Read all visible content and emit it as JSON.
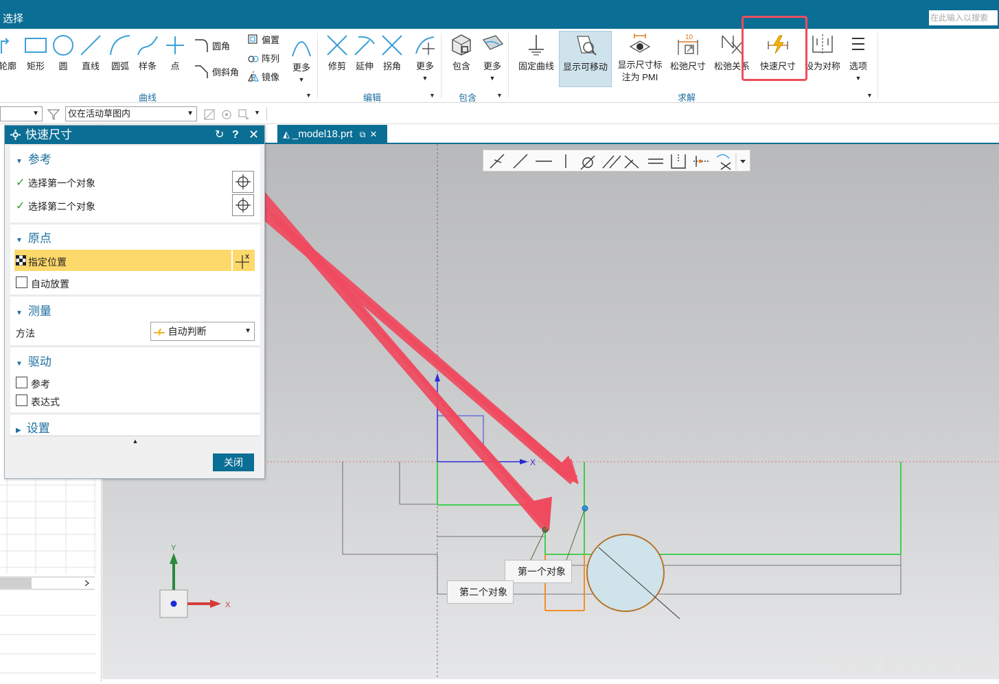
{
  "titlebar": {
    "menu": "选择",
    "search_placeholder": "在此输入以搜索"
  },
  "ribbon": {
    "curve": {
      "items": [
        "轮廓",
        "矩形",
        "圆",
        "直线",
        "圆弧",
        "样条",
        "点"
      ],
      "fillet": "圆角",
      "chamfer": "倒斜角",
      "offset": "偏置",
      "array": "阵列",
      "mirror": "镜像",
      "more": "更多",
      "group": "曲线"
    },
    "edit": {
      "trim": "修剪",
      "extend": "延伸",
      "corner": "拐角",
      "more": "更多",
      "group": "编辑"
    },
    "include": {
      "include": "包含",
      "more": "更多",
      "group": "包含"
    },
    "solve": {
      "fix_curve": "固定曲线",
      "show_movable": "显示可移动",
      "show_dim_line1": "显示尺寸标",
      "show_dim_line2": "注为 PMI",
      "relax_dim": "松弛尺寸",
      "relax_rel": "松弛关系",
      "rapid_dim": "快速尺寸",
      "set_symmetric": "设为对称",
      "options": "选项",
      "group": "求解"
    }
  },
  "selbar": {
    "scope": "仅在活动草图内"
  },
  "tab": {
    "label": "_model18.prt"
  },
  "dialog": {
    "title": "快速尺寸",
    "ref": {
      "header": "参考",
      "first": "选择第一个对象",
      "second": "选择第二个对象"
    },
    "origin": {
      "header": "原点",
      "specify": "指定位置",
      "auto": "自动放置"
    },
    "measure": {
      "header": "测量",
      "method_label": "方法",
      "method_value": "自动判断"
    },
    "drive": {
      "header": "驱动",
      "reference": "参考",
      "expression": "表达式"
    },
    "settings": {
      "header": "设置"
    },
    "close": "关闭"
  },
  "canvas": {
    "callout_first": "第一个对象",
    "callout_second": "第二个对象",
    "axis_x": "X",
    "axis_y": "Y"
  },
  "watermark": "CSDN @王小妹1116",
  "colors": {
    "brand": "#0b6e94",
    "highlight": "#ef4d5d",
    "accent_text": "#1c6ea0",
    "sketch_green": "#2ecc40",
    "circle_fill": "#cfe3ea",
    "circle_stroke": "#b5742a"
  }
}
